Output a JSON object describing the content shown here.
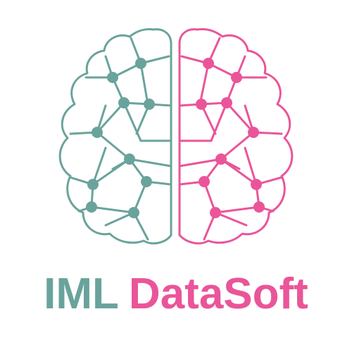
{
  "logo": {
    "word_left": "IML",
    "word_right": "DataSoft",
    "icon": "brain-network-icon"
  },
  "colors": {
    "left": "#6aa39c",
    "right": "#ea5599",
    "background": "#ffffff"
  }
}
